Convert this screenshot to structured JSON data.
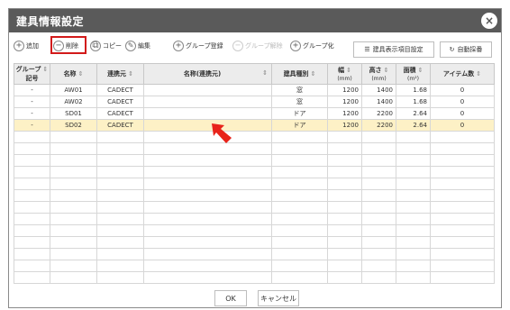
{
  "dialog": {
    "title": "建具情報設定",
    "close_glyph": "×"
  },
  "toolbar": {
    "add": "追加",
    "delete": "削除",
    "copy": "コピー",
    "edit": "編集",
    "group_register": "グループ登録",
    "group_release": "グループ解除",
    "group_make": "グループ化",
    "display_settings": "建具表示項目設定",
    "auto_number": "自動採番"
  },
  "colors": {
    "title_bar": "#5a5a5a",
    "highlight_box": "#d21a1a",
    "selected_row": "#fdf1c6",
    "arrow": "#e8231a"
  },
  "table": {
    "headers": {
      "group_line1": "グループ",
      "group_line2": "記号",
      "name": "名称",
      "source": "連携元",
      "link_name": "名称(連携元)",
      "type": "建具種別",
      "width": "幅",
      "width_unit": "(mm)",
      "height": "高さ",
      "height_unit": "(mm)",
      "area": "面積",
      "area_unit": "(m²)",
      "count": "アイテム数"
    },
    "rows": [
      {
        "group": "-",
        "name": "AW01",
        "source": "CADECT",
        "link_name": "",
        "type": "窓",
        "width": "1200",
        "height": "1400",
        "area": "1.68",
        "count": "0"
      },
      {
        "group": "-",
        "name": "AW02",
        "source": "CADECT",
        "link_name": "",
        "type": "窓",
        "width": "1200",
        "height": "1400",
        "area": "1.68",
        "count": "0"
      },
      {
        "group": "-",
        "name": "SD01",
        "source": "CADECT",
        "link_name": "",
        "type": "ドア",
        "width": "1200",
        "height": "2200",
        "area": "2.64",
        "count": "0"
      },
      {
        "group": "-",
        "name": "SD02",
        "source": "CADECT",
        "link_name": "",
        "type": "ドア",
        "width": "1200",
        "height": "2200",
        "area": "2.64",
        "count": "0"
      }
    ]
  },
  "footer": {
    "ok": "OK",
    "cancel": "キャンセル"
  }
}
